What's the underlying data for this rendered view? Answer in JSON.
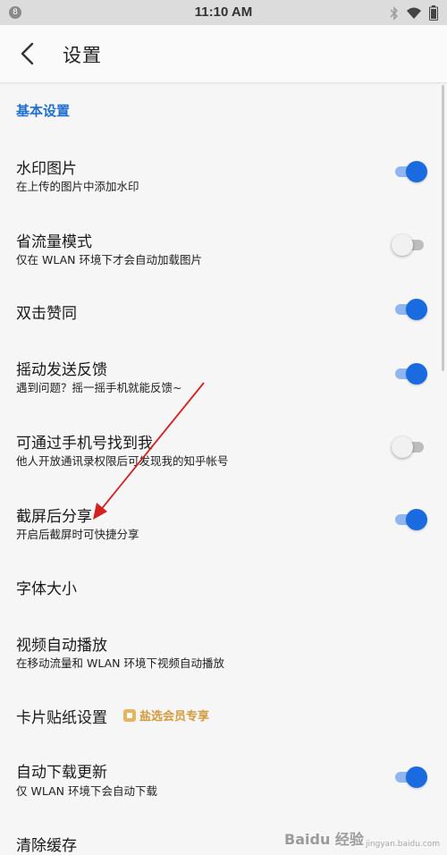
{
  "status_bar": {
    "time": "11:10 AM",
    "left_icon": "notification-icon",
    "right_icons": [
      "bluetooth-icon",
      "wifi-icon",
      "battery-icon"
    ]
  },
  "toolbar": {
    "back_icon": "chevron-left-icon",
    "title": "设置"
  },
  "section": {
    "title": "基本设置"
  },
  "settings": [
    {
      "title": "水印图片",
      "subtitle": "在上传的图片中添加水印",
      "toggle": true
    },
    {
      "title": "省流量模式",
      "subtitle": "仅在 WLAN 环境下才会自动加载图片",
      "toggle": false
    },
    {
      "title": "双击赞同",
      "subtitle": "",
      "toggle": true
    },
    {
      "title": "摇动发送反馈",
      "subtitle": "遇到问题？摇一摇手机就能反馈~",
      "toggle": true
    },
    {
      "title": "可通过手机号找到我",
      "subtitle": "他人开放通讯录权限后可发现我的知乎帐号",
      "toggle": false
    },
    {
      "title": "截屏后分享",
      "subtitle": "开启后截屏时可快捷分享",
      "toggle": true
    },
    {
      "title": "字体大小",
      "subtitle": ""
    },
    {
      "title": "视频自动播放",
      "subtitle": "在移动流量和 WLAN 环境下视频自动播放"
    },
    {
      "title": "卡片贴纸设置",
      "subtitle": "",
      "badge": "盐选会员专享"
    },
    {
      "title": "自动下载更新",
      "subtitle": "仅 WLAN 环境下会自动下载",
      "toggle": true
    },
    {
      "title": "清除缓存",
      "subtitle": ""
    }
  ],
  "colors": {
    "accent": "#1a6be0",
    "section_header": "#1e6fd0",
    "badge": "#d49a3c",
    "annotation_arrow": "#d42020"
  },
  "watermark": {
    "brand": "Baidu 经验",
    "url": "jingyan.baidu.com"
  }
}
